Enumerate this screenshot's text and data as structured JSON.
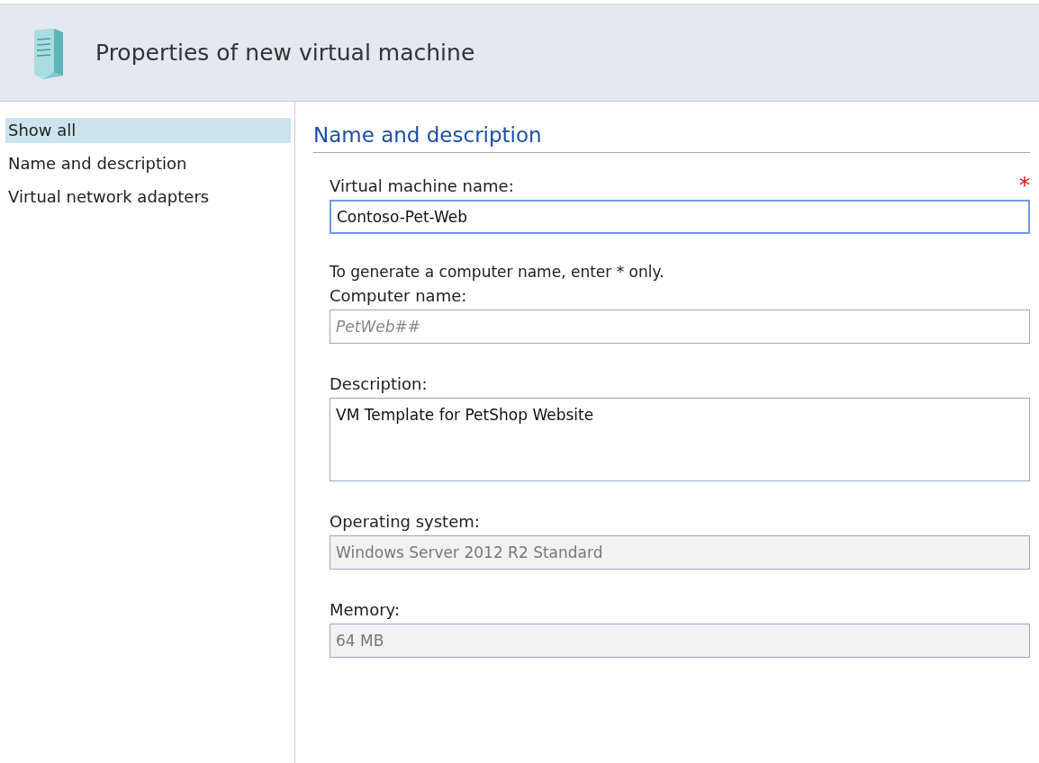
{
  "header": {
    "title": "Properties of new virtual machine"
  },
  "sidebar": {
    "items": [
      {
        "label": "Show all",
        "selected": true
      },
      {
        "label": "Name and description",
        "selected": false
      },
      {
        "label": "Virtual network adapters",
        "selected": false
      }
    ]
  },
  "section": {
    "title": "Name and description"
  },
  "fields": [
    {
      "kind": "text",
      "label": "Virtual machine name:",
      "required_mark": "*",
      "focused": true,
      "disabled": false,
      "value": "Contoso-Pet-Web"
    },
    {
      "kind": "text",
      "hint": "To generate a computer name, enter * only.",
      "label": "Computer name:",
      "focused": false,
      "disabled": false,
      "placeholder": "PetWeb##"
    },
    {
      "kind": "textarea",
      "label": "Description:",
      "focused": false,
      "disabled": false,
      "value": "VM Template for PetShop Website"
    },
    {
      "kind": "text",
      "label": "Operating system:",
      "focused": false,
      "disabled": true,
      "value": "Windows Server 2012 R2 Standard"
    },
    {
      "kind": "text",
      "label": "Memory:",
      "focused": false,
      "disabled": true,
      "value": "64 MB"
    }
  ]
}
